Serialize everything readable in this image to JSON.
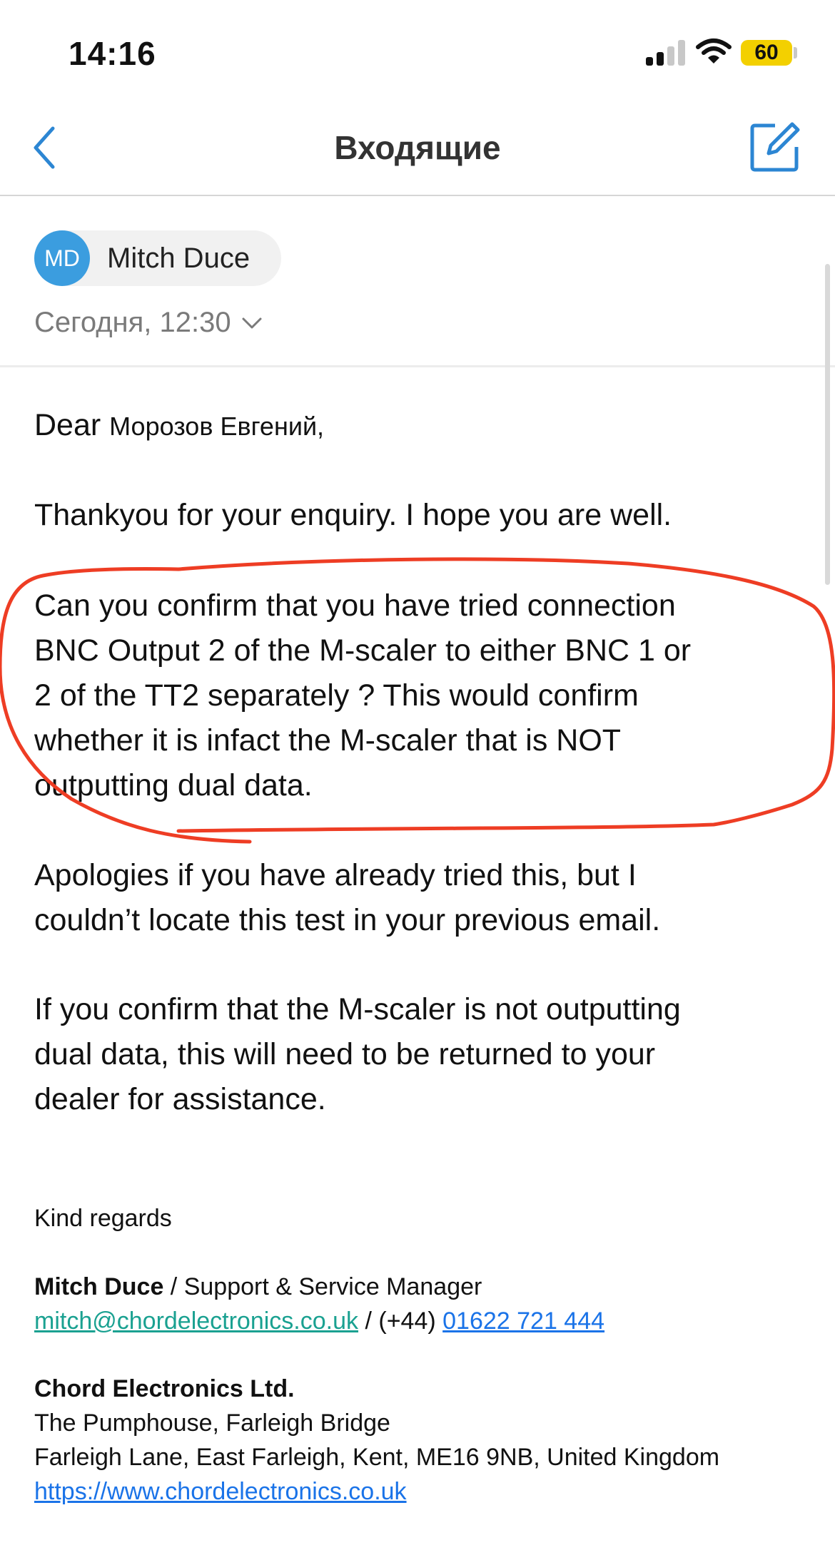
{
  "status_bar": {
    "time": "14:16",
    "battery": "60"
  },
  "nav": {
    "title": "Входящие"
  },
  "header": {
    "avatar_initials": "MD",
    "sender": "Mitch Duce",
    "date": "Сегодня, 12:30"
  },
  "email": {
    "greeting_dear": "Dear",
    "greeting_name": "Морозов Евгений,",
    "p1": "Thankyou for your enquiry. I hope you are well.",
    "p2": [
      "Can you confirm that you have tried connection",
      "BNC Output 2 of the M-scaler to either BNC 1 or",
      "2 of the TT2 separately ? This would confirm",
      "whether it is infact the M-scaler that is NOT",
      "outputting dual data."
    ],
    "p3": [
      "Apologies if you have already tried this, but I",
      "couldn’t locate this test in your previous email."
    ],
    "p4": [
      "If you confirm that the M-scaler is not outputting",
      "dual data, this will need to be returned to your",
      "dealer for assistance."
    ]
  },
  "signature": {
    "closing": "Kind regards",
    "name": "Mitch Duce",
    "role": " / Support & Service Manager",
    "email": "mitch@chordelectronics.co.uk",
    "phone_prefix": " / (+44) ",
    "phone": "01622 721 444",
    "company": "Chord Electronics Ltd.",
    "address1": "The Pumphouse, Farleigh Bridge",
    "address2": "Farleigh Lane, East Farleigh, Kent, ME16 9NB, United Kingdom",
    "website": "https://www.chordelectronics.co.uk"
  },
  "colors": {
    "accent": "#1a73e8",
    "annotation": "#ee3d24",
    "avatar": "#3b9ddf",
    "battery": "#f3d000"
  }
}
